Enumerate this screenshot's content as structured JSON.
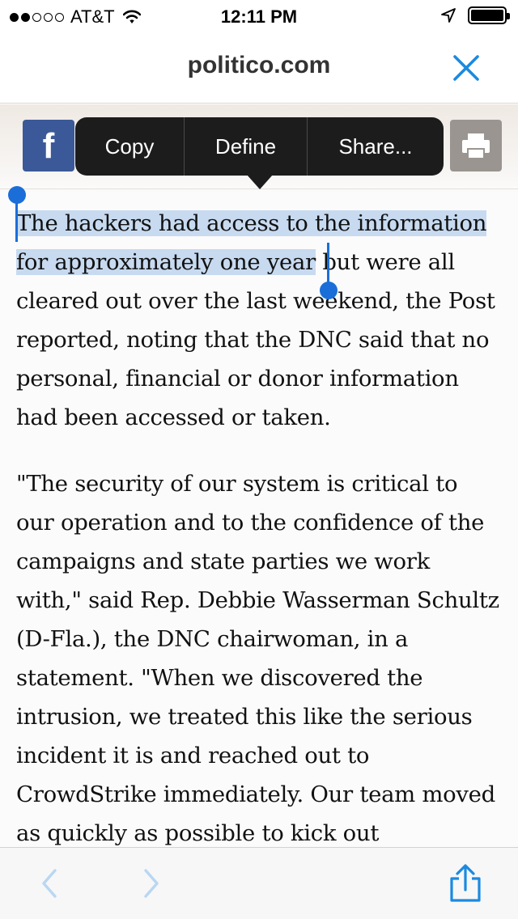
{
  "status_bar": {
    "carrier": "AT&T",
    "time": "12:11 PM",
    "signal_bars_filled": 2,
    "signal_bars_total": 5
  },
  "header": {
    "url": "politico.com"
  },
  "edit_menu": {
    "copy": "Copy",
    "define": "Define",
    "share": "Share..."
  },
  "share_bar": {
    "facebook_glyph": "f"
  },
  "article": {
    "paragraph1_selected": "The hackers had access to the information for approximately one year",
    "paragraph1_rest": " but were all cleared out over the last weekend, the Post reported, noting that the DNC said that no personal, financial or donor information had been accessed or taken.",
    "paragraph2": "\"The security of our system is critical to our operation and to the confidence of the campaigns and state parties we work with,\" said Rep. Debbie Wasserman Schultz (D-Fla.), the DNC chairwoman, in a statement. \"When we discovered the intrusion, we treated this like the serious incident it is and reached out to CrowdStrike immediately. Our team moved as quickly as possible to kick out"
  },
  "colors": {
    "accent": "#1b8ae0",
    "selection": "#c7daf0",
    "handle": "#1b6ed8",
    "facebook": "#3b5998",
    "menu_bg": "#1c1c1c"
  },
  "icons": {
    "close": "close-icon",
    "back": "chevron-left-icon",
    "forward": "chevron-right-icon",
    "share": "share-icon",
    "print": "print-icon",
    "location": "location-arrow-icon",
    "wifi": "wifi-icon",
    "battery": "battery-icon"
  }
}
